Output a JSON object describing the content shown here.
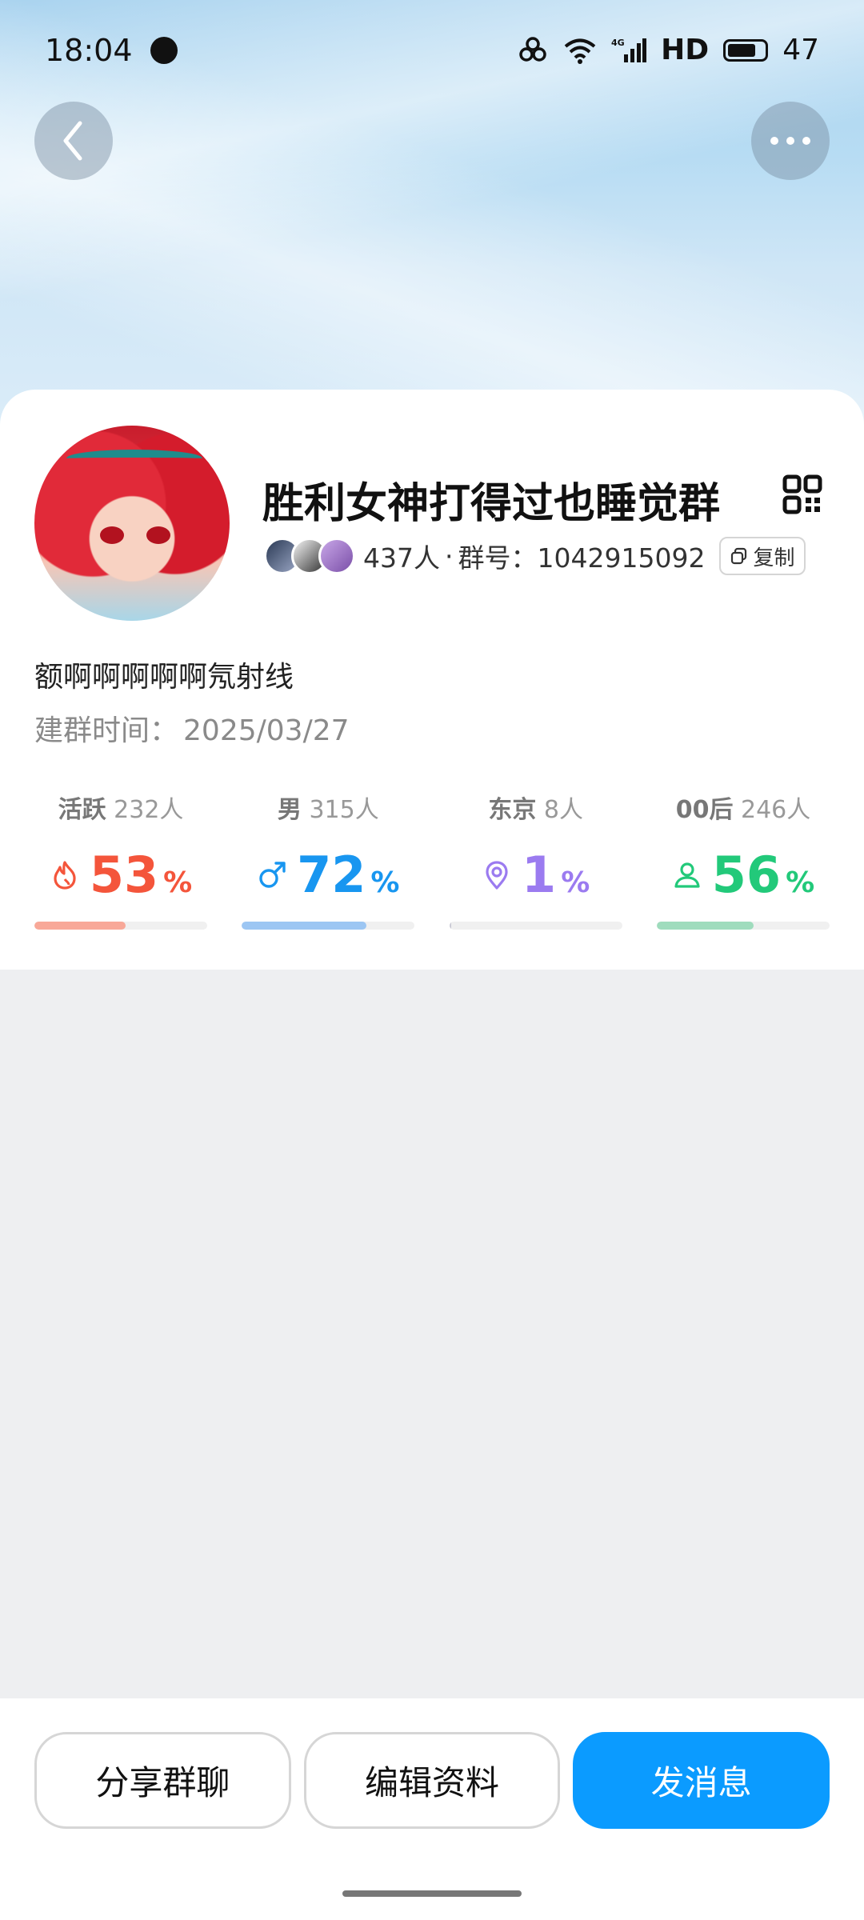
{
  "status_bar": {
    "time": "18:04",
    "network": "HD",
    "signal_label": "4G",
    "battery": "47"
  },
  "header": {
    "back_icon": "chevron-left-icon",
    "more_icon": "more-horizontal-icon"
  },
  "group": {
    "name": "胜利女神打得过也睡觉群",
    "member_count": "437人",
    "separator": "·",
    "group_id_label": "群号：1042915092",
    "copy_label": "复制",
    "description": "额啊啊啊啊啊氖射线",
    "created_label": "建群时间：",
    "created_date": "2025/03/27"
  },
  "stats": [
    {
      "key": "active",
      "label": "活跃",
      "count": "232人",
      "value": "53",
      "unit": "%",
      "percent": 53,
      "color": "#f4553b",
      "bar_color": "#f8a898",
      "icon": "flame-icon"
    },
    {
      "key": "male",
      "label": "男",
      "count": "315人",
      "value": "72",
      "unit": "%",
      "percent": 72,
      "color": "#1896f0",
      "bar_color": "#9cc6f3",
      "icon": "male-icon"
    },
    {
      "key": "location",
      "label": "东京",
      "count": "8人",
      "value": "1",
      "unit": "%",
      "percent": 1,
      "color": "#9b7bf0",
      "bar_color": "#c9c9d4",
      "icon": "location-pin-icon"
    },
    {
      "key": "age",
      "label": "00后",
      "count": "246人",
      "value": "56",
      "unit": "%",
      "percent": 56,
      "color": "#22c97a",
      "bar_color": "#9fdcbd",
      "icon": "person-icon"
    }
  ],
  "actions": {
    "share": "分享群聊",
    "edit": "编辑资料",
    "send": "发消息"
  }
}
